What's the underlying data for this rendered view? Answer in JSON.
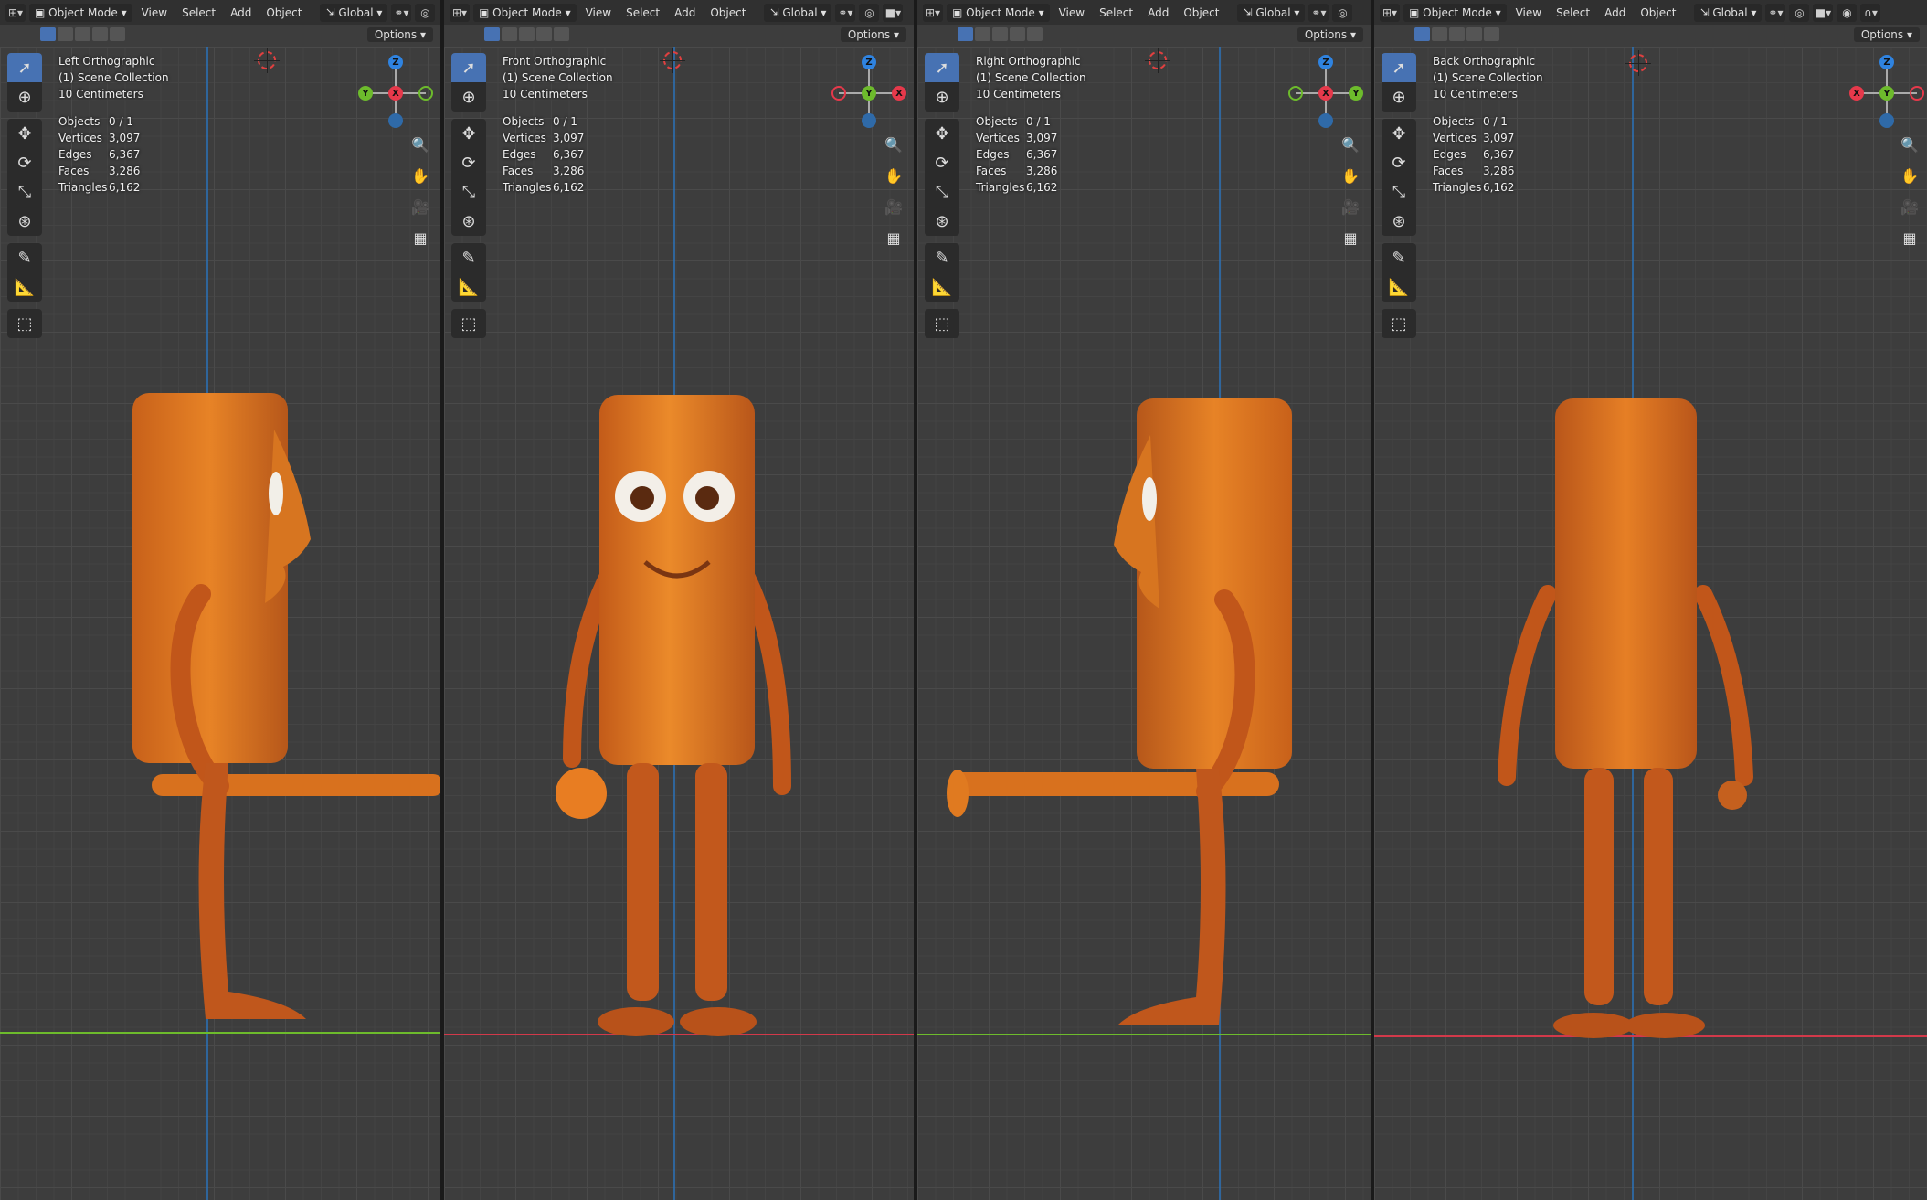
{
  "header": {
    "mode": "Object Mode",
    "menus": [
      "View",
      "Select",
      "Add",
      "Object"
    ],
    "orientation": "Global",
    "options_label": "Options"
  },
  "collection": "(1) Scene Collection",
  "scale": "10 Centimeters",
  "stats": [
    {
      "label": "Objects",
      "value": "0 / 1"
    },
    {
      "label": "Vertices",
      "value": "3,097"
    },
    {
      "label": "Edges",
      "value": "6,367"
    },
    {
      "label": "Faces",
      "value": "3,286"
    },
    {
      "label": "Triangles",
      "value": "6,162"
    }
  ],
  "viewports": [
    {
      "view": "Left Orthographic"
    },
    {
      "view": "Front Orthographic"
    },
    {
      "view": "Right Orthographic"
    },
    {
      "view": "Back Orthographic"
    }
  ],
  "gizmo_axes": {
    "left": [
      "Z",
      "Y",
      "X"
    ],
    "front": [
      "Z",
      "Y",
      "X"
    ],
    "right": [
      "Z",
      "X",
      "Y"
    ],
    "back": [
      "Z",
      "X",
      "Y"
    ]
  },
  "colors": {
    "accent": "#4772b3",
    "x_axis": "#e6394b",
    "y_axis": "#6dbb2c",
    "z_axis": "#2f83e0",
    "model_orange": "#e07a1e"
  }
}
